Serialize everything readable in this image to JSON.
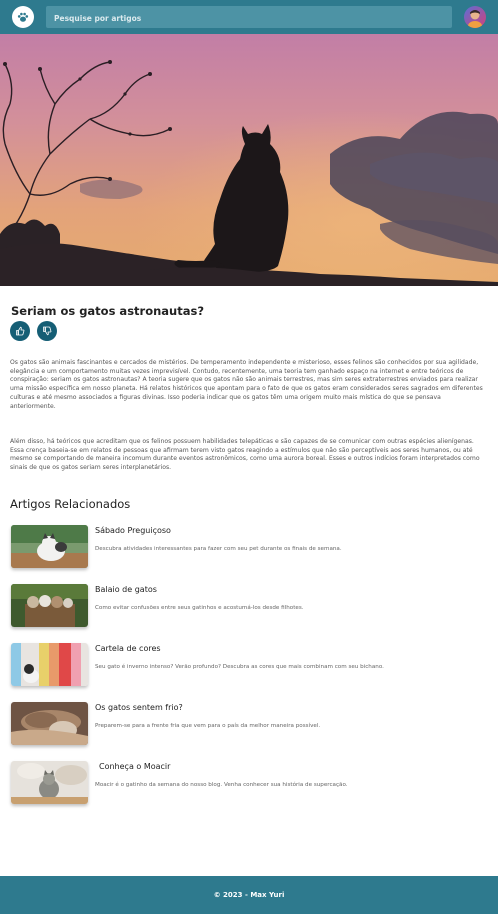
{
  "header": {
    "logo_icon": "paw-icon",
    "search_placeholder": "Pesquise por artigos",
    "avatar_icon": "user-avatar",
    "bar_color": "#2e7a8e"
  },
  "article": {
    "title": "Seriam os gatos astronautas?",
    "like_icon": "thumbs-up-icon",
    "dislike_icon": "thumbs-down-icon",
    "paragraph_1": "Os gatos são animais fascinantes e cercados de mistérios. De temperamento independente e misterioso, esses felinos são conhecidos por sua agilidade, elegância e um comportamento muitas vezes imprevisível. Contudo, recentemente, uma teoria tem ganhado espaço na internet e entre teóricos de conspiração: seriam os gatos astronautas? A teoria sugere que os gatos não são animais terrestres, mas sim seres extraterrestres enviados para realizar uma missão específica em nosso planeta. Há relatos históricos que apontam para o fato de que os gatos eram considerados seres sagrados em diferentes culturas e até mesmo associados a figuras divinas. Isso poderia indicar que os gatos têm uma origem muito mais mística do que se pensava anteriormente.",
    "paragraph_2": "Além disso, há teóricos que acreditam que os felinos possuem habilidades telepáticas e são capazes de se comunicar com outras espécies alienígenas. Essa crença baseia-se em relatos de pessoas que afirmam terem visto gatos reagindo a estímulos que não são perceptíveis aos seres humanos, ou até mesmo se comportando de maneira incomum durante eventos astronômicos, como uma aurora boreal. Esses e outros indícios foram interpretados como sinais de que os gatos seriam seres interplanetários."
  },
  "related": {
    "heading": "Artigos Relacionados",
    "items": [
      {
        "title": "Sábado Preguiçoso",
        "description": "Descubra atividades interessantes para fazer com seu pet durante os finais de semana."
      },
      {
        "title": "Balaio de gatos",
        "description": "Como evitar confusões entre seus gatinhos e acostumá-los desde filhotes."
      },
      {
        "title": "Cartela de cores",
        "description": "Seu gato é inverno intenso? Verão profundo? Descubra as cores que mais combinam com seu bichano."
      },
      {
        "title": "Os gatos sentem frio?",
        "description": "Preparem-se para a frente fria que vem para o país da melhor maneira possível."
      },
      {
        "title": "Conheça o Moacir",
        "description": "Moacir é o gatinho da semana do nosso blog. Venha conhecer sua história de supercação."
      }
    ]
  },
  "footer": {
    "text": "© 2023 - Max Yuri"
  }
}
